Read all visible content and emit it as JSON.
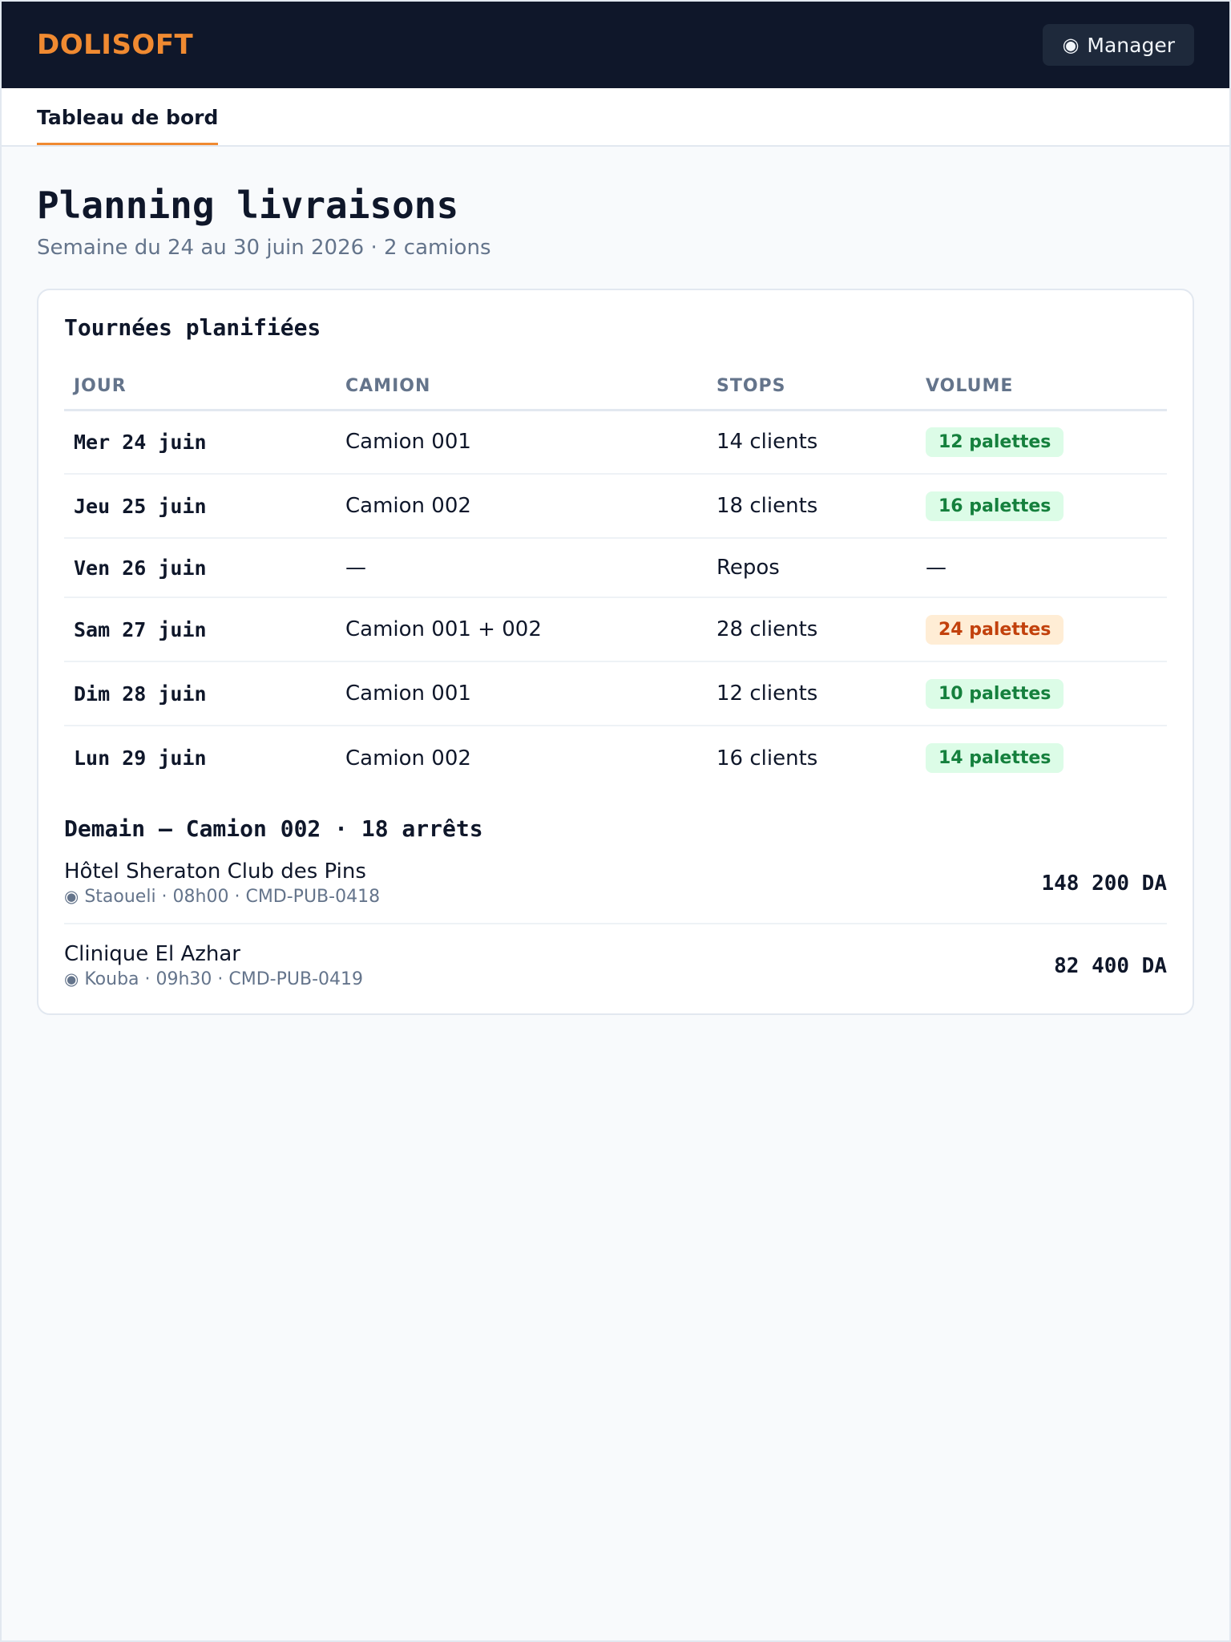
{
  "app": {
    "brand": "DOLISOFT"
  },
  "user": {
    "icon": "user-icon",
    "label": "Manager"
  },
  "nav": {
    "tabs": [
      {
        "label": "Tableau de bord",
        "active": true
      }
    ]
  },
  "page": {
    "title": "Planning livraisons",
    "subtitle": "Semaine du 24 au 30 juin 2026 · 2 camions"
  },
  "tours": {
    "title": "Tournées planifiées",
    "columns": [
      "JOUR",
      "CAMION",
      "STOPS",
      "VOLUME"
    ],
    "rows": [
      {
        "day": "Mer 24 juin",
        "truck": "Camion 001",
        "stops": "14 clients",
        "volume": "12 palettes",
        "status": "green"
      },
      {
        "day": "Jeu 25 juin",
        "truck": "Camion 002",
        "stops": "18 clients",
        "volume": "16 palettes",
        "status": "green"
      },
      {
        "day": "Ven 26 juin",
        "truck": "—",
        "stops": "Repos",
        "volume": "—",
        "status": "none"
      },
      {
        "day": "Sam 27 juin",
        "truck": "Camion 001 + 002",
        "stops": "28 clients",
        "volume": "24 palettes",
        "status": "orange"
      },
      {
        "day": "Dim 28 juin",
        "truck": "Camion 001",
        "stops": "12 clients",
        "volume": "10 palettes",
        "status": "green"
      },
      {
        "day": "Lun 29 juin",
        "truck": "Camion 002",
        "stops": "16 clients",
        "volume": "14 palettes",
        "status": "green"
      }
    ]
  },
  "tomorrow": {
    "title": "Demain — Camion 002 · 18 arrêts",
    "deliveries": [
      {
        "name": "Hôtel Sheraton Club des Pins",
        "meta": "Staoueli · 08h00 · CMD-PUB-0418",
        "amount": "148 200 DA"
      },
      {
        "name": "Clinique El Azhar",
        "meta": "Kouba · 09h30 · CMD-PUB-0419",
        "amount": "82 400 DA"
      }
    ]
  },
  "colors": {
    "header_bg": "#0f172a",
    "brand": "#f08a31",
    "badge_green_bg": "#dcfce7",
    "badge_green_text": "#15803d",
    "badge_orange_bg": "#ffedd5",
    "badge_orange_text": "#c2410c"
  }
}
